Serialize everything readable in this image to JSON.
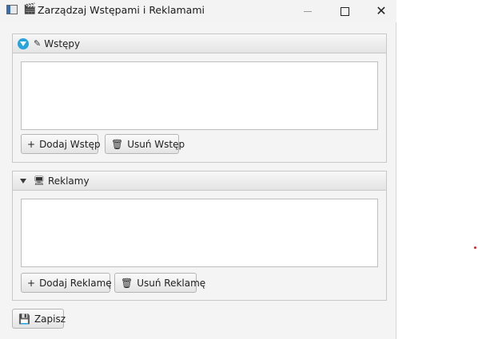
{
  "window": {
    "title": "Zarządzaj Wstępami i Reklamami",
    "title_glyph": "🎬",
    "minimize": "—",
    "close": "✕"
  },
  "intros": {
    "header_icon": "✎",
    "header_label": "Wstępy",
    "add_icon": "+",
    "add_label": "Dodaj Wstęp",
    "remove_icon": "🗑",
    "remove_label": "Usuń Wstęp",
    "items": []
  },
  "ads": {
    "header_icon": "🖥",
    "header_label": "Reklamy",
    "add_icon": "+",
    "add_label": "Dodaj Reklamę",
    "remove_icon": "🗑",
    "remove_label": "Usuń Reklamę",
    "items": []
  },
  "footer": {
    "save_icon": "💾",
    "save_label": "Zapisz"
  },
  "colors": {
    "accent": "#27a4dc",
    "window_bg": "#f4f4f4",
    "pane_header": "#e4e4e4",
    "indicator_dot": "#e2231a"
  }
}
